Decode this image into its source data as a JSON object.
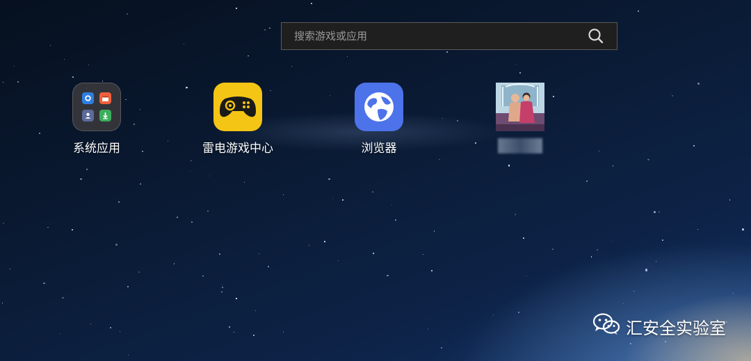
{
  "search": {
    "placeholder": "搜索游戏或应用",
    "icon": "search-icon"
  },
  "apps": [
    {
      "label": "系统应用",
      "icon": "system-apps-folder-icon",
      "color": "#37373c"
    },
    {
      "label": "雷电游戏中心",
      "icon": "gamepad-icon",
      "color": "#f4c514"
    },
    {
      "label": "浏览器",
      "icon": "globe-icon",
      "color": "#4d73ea"
    },
    {
      "label": "",
      "icon": "app-photo-icon"
    }
  ],
  "watermark": {
    "text": "汇安全实验室",
    "icon": "wechat-icon"
  },
  "colors": {
    "background": "#0a1a33",
    "search_bg": "#1f1f1f",
    "search_border": "#5a5a5a"
  }
}
